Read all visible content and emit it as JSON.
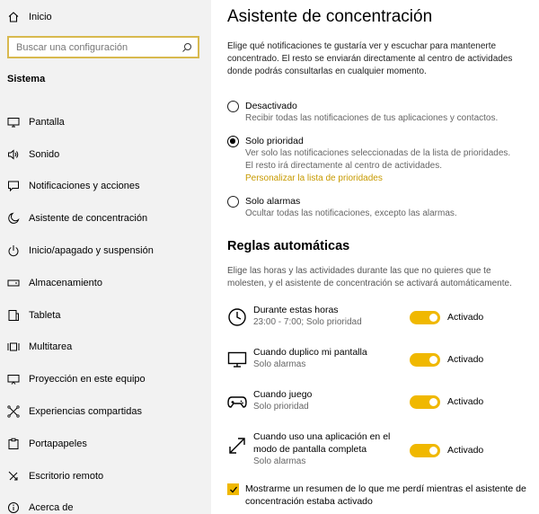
{
  "sidebar": {
    "home_label": "Inicio",
    "search_placeholder": "Buscar una configuración",
    "section_title": "Sistema",
    "items": [
      {
        "label": "Pantalla",
        "icon": "monitor-icon"
      },
      {
        "label": "Sonido",
        "icon": "speaker-icon"
      },
      {
        "label": "Notificaciones y acciones",
        "icon": "notification-icon"
      },
      {
        "label": "Asistente de concentración",
        "icon": "moon-icon"
      },
      {
        "label": "Inicio/apagado y suspensión",
        "icon": "power-icon"
      },
      {
        "label": "Almacenamiento",
        "icon": "storage-icon"
      },
      {
        "label": "Tableta",
        "icon": "tablet-icon"
      },
      {
        "label": "Multitarea",
        "icon": "multitask-icon"
      },
      {
        "label": "Proyección en este equipo",
        "icon": "projection-icon"
      },
      {
        "label": "Experiencias compartidas",
        "icon": "shared-experiences-icon"
      },
      {
        "label": "Portapapeles",
        "icon": "clipboard-icon"
      },
      {
        "label": "Escritorio remoto",
        "icon": "remote-desktop-icon"
      },
      {
        "label": "Acerca de",
        "icon": "info-icon"
      }
    ]
  },
  "main": {
    "title": "Asistente de concentración",
    "intro": "Elige qué notificaciones te gustaría ver y escuchar para mantenerte concentrado. El resto se enviarán directamente al centro de actividades donde podrás consultarlas en cualquier momento.",
    "options": [
      {
        "label": "Desactivado",
        "desc": "Recibir todas las notificaciones de tus aplicaciones y contactos.",
        "checked": false
      },
      {
        "label": "Solo prioridad",
        "desc1": "Ver solo las notificaciones seleccionadas de la lista de prioridades.",
        "desc2": "El resto irá directamente al centro de actividades.",
        "link": "Personalizar la lista de prioridades",
        "checked": true
      },
      {
        "label": "Solo alarmas",
        "desc": "Ocultar todas las notificaciones, excepto las alarmas.",
        "checked": false
      }
    ],
    "rules_title": "Reglas automáticas",
    "rules_intro": "Elige las horas y las actividades durante las que no quieres que te molesten, y el asistente de concentración se activará automáticamente.",
    "rules": [
      {
        "label": "Durante estas horas",
        "sub": "23:00 - 7:00; Solo prioridad",
        "state": "Activado",
        "icon": "clock-icon",
        "on": true
      },
      {
        "label": "Cuando duplico mi pantalla",
        "sub": "Solo alarmas",
        "state": "Activado",
        "icon": "display-icon",
        "on": true
      },
      {
        "label": "Cuando juego",
        "sub": "Solo prioridad",
        "state": "Activado",
        "icon": "gamepad-icon",
        "on": true
      },
      {
        "label": "Cuando uso una aplicación en el modo de pantalla completa",
        "sub": "Solo alarmas",
        "state": "Activado",
        "icon": "fullscreen-icon",
        "on": true
      }
    ],
    "summary_label": "Mostrarme un resumen de lo que me perdí mientras el asistente de concentración estaba activado",
    "summary_checked": true
  },
  "colors": {
    "accent": "#f0b800",
    "link": "#c79a00",
    "sidebar_bg": "#f2f2f2",
    "search_border": "#d8b94e"
  }
}
